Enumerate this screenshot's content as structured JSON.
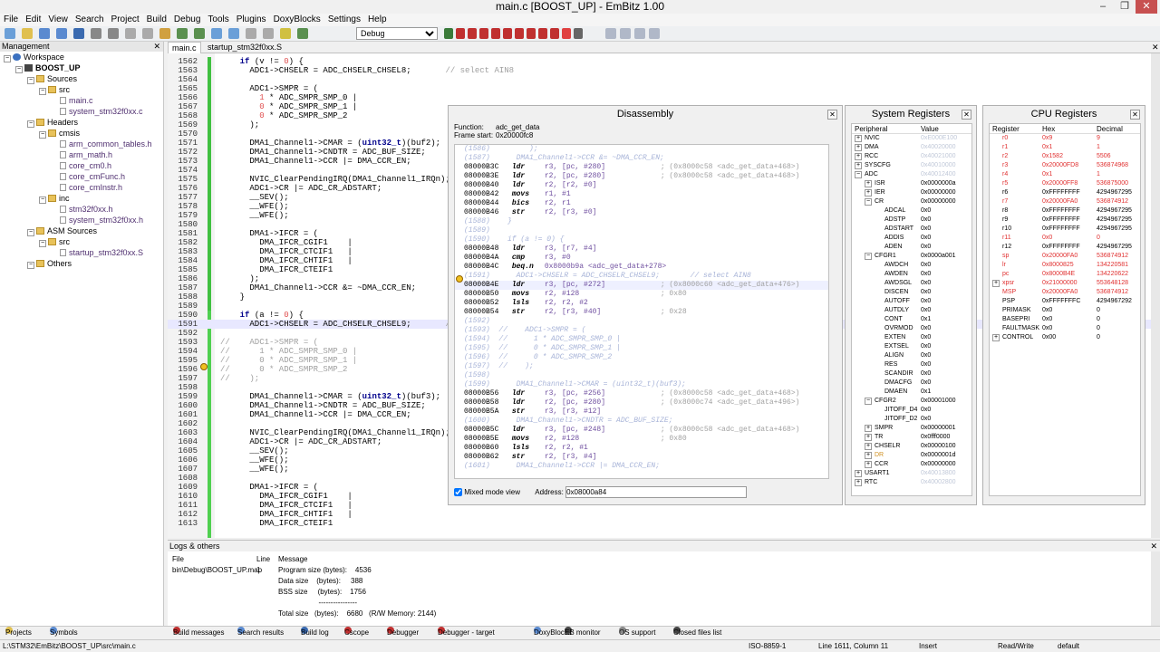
{
  "window": {
    "title": "main.c [BOOST_UP] - EmBitz 1.00"
  },
  "menu": [
    "File",
    "Edit",
    "View",
    "Search",
    "Project",
    "Build",
    "Debug",
    "Tools",
    "Plugins",
    "DoxyBlocks",
    "Settings",
    "Help"
  ],
  "toolbar": {
    "build_target": "Debug"
  },
  "management": {
    "title": "Management",
    "tree": [
      {
        "label": "Workspace",
        "indent": 0,
        "kind": "ws"
      },
      {
        "label": "BOOST_UP",
        "indent": 1,
        "kind": "proj"
      },
      {
        "label": "Sources",
        "indent": 2,
        "kind": "folder"
      },
      {
        "label": "src",
        "indent": 3,
        "kind": "folder"
      },
      {
        "label": "main.c",
        "indent": 4,
        "kind": "file"
      },
      {
        "label": "system_stm32f0xx.c",
        "indent": 4,
        "kind": "file"
      },
      {
        "label": "Headers",
        "indent": 2,
        "kind": "folder"
      },
      {
        "label": "cmsis",
        "indent": 3,
        "kind": "folder"
      },
      {
        "label": "arm_common_tables.h",
        "indent": 4,
        "kind": "file"
      },
      {
        "label": "arm_math.h",
        "indent": 4,
        "kind": "file"
      },
      {
        "label": "core_cm0.h",
        "indent": 4,
        "kind": "file"
      },
      {
        "label": "core_cmFunc.h",
        "indent": 4,
        "kind": "file"
      },
      {
        "label": "core_cmInstr.h",
        "indent": 4,
        "kind": "file"
      },
      {
        "label": "inc",
        "indent": 3,
        "kind": "folder"
      },
      {
        "label": "stm32f0xx.h",
        "indent": 4,
        "kind": "file"
      },
      {
        "label": "system_stm32f0xx.h",
        "indent": 4,
        "kind": "file"
      },
      {
        "label": "ASM Sources",
        "indent": 2,
        "kind": "folder"
      },
      {
        "label": "src",
        "indent": 3,
        "kind": "folder"
      },
      {
        "label": "startup_stm32f0xx.S",
        "indent": 4,
        "kind": "file"
      },
      {
        "label": "Others",
        "indent": 2,
        "kind": "folder"
      }
    ]
  },
  "editor": {
    "tabs": [
      "main.c",
      "startup_stm32f0xx.S"
    ],
    "lines": [
      {
        "n": "1562",
        "t": "    if (v != 0) {"
      },
      {
        "n": "1563",
        "t": "      ADC1->CHSELR = ADC_CHSELR_CHSEL8;       // select AIN8"
      },
      {
        "n": "1564",
        "t": ""
      },
      {
        "n": "1565",
        "t": "      ADC1->SMPR = ("
      },
      {
        "n": "1566",
        "t": "        1 * ADC_SMPR_SMP_0 |"
      },
      {
        "n": "1567",
        "t": "        0 * ADC_SMPR_SMP_1 |"
      },
      {
        "n": "1568",
        "t": "        0 * ADC_SMPR_SMP_2"
      },
      {
        "n": "1569",
        "t": "      );"
      },
      {
        "n": "1570",
        "t": ""
      },
      {
        "n": "1571",
        "t": "      DMA1_Channel1->CMAR = (uint32_t)(buf2);"
      },
      {
        "n": "1572",
        "t": "      DMA1_Channel1->CNDTR = ADC_BUF_SIZE;"
      },
      {
        "n": "1573",
        "t": "      DMA1_Channel1->CCR |= DMA_CCR_EN;"
      },
      {
        "n": "1574",
        "t": ""
      },
      {
        "n": "1575",
        "t": "      NVIC_ClearPendingIRQ(DMA1_Channel1_IRQn);"
      },
      {
        "n": "1576",
        "t": "      ADC1->CR |= ADC_CR_ADSTART;              // start th"
      },
      {
        "n": "1577",
        "t": "      __SEV();"
      },
      {
        "n": "1578",
        "t": "      __WFE();"
      },
      {
        "n": "1579",
        "t": "      __WFE();"
      },
      {
        "n": "1580",
        "t": ""
      },
      {
        "n": "1581",
        "t": "      DMA1->IFCR = ("
      },
      {
        "n": "1582",
        "t": "        DMA_IFCR_CGIF1    |"
      },
      {
        "n": "1583",
        "t": "        DMA_IFCR_CTCIF1   |"
      },
      {
        "n": "1584",
        "t": "        DMA_IFCR_CHTIF1   |"
      },
      {
        "n": "1585",
        "t": "        DMA_IFCR_CTEIF1"
      },
      {
        "n": "1586",
        "t": "      );"
      },
      {
        "n": "1587",
        "t": "      DMA1_Channel1->CCR &= ~DMA_CCR_EN;"
      },
      {
        "n": "1588",
        "t": "    }"
      },
      {
        "n": "1589",
        "t": ""
      },
      {
        "n": "1590",
        "t": "    if (a != 0) {"
      },
      {
        "n": "1591",
        "t": "      ADC1->CHSELR = ADC_CHSELR_CHSEL9;       // select A"
      },
      {
        "n": "1592",
        "t": ""
      },
      {
        "n": "1593",
        "t": "//    ADC1->SMPR = ("
      },
      {
        "n": "1594",
        "t": "//      1 * ADC_SMPR_SMP_0 |"
      },
      {
        "n": "1595",
        "t": "//      0 * ADC_SMPR_SMP_1 |"
      },
      {
        "n": "1596",
        "t": "//      0 * ADC_SMPR_SMP_2"
      },
      {
        "n": "1597",
        "t": "//    );"
      },
      {
        "n": "1598",
        "t": ""
      },
      {
        "n": "1599",
        "t": "      DMA1_Channel1->CMAR = (uint32_t)(buf3);"
      },
      {
        "n": "1600",
        "t": "      DMA1_Channel1->CNDTR = ADC_BUF_SIZE;"
      },
      {
        "n": "1601",
        "t": "      DMA1_Channel1->CCR |= DMA_CCR_EN;"
      },
      {
        "n": "1602",
        "t": ""
      },
      {
        "n": "1603",
        "t": "      NVIC_ClearPendingIRQ(DMA1_Channel1_IRQn);"
      },
      {
        "n": "1604",
        "t": "      ADC1->CR |= ADC_CR_ADSTART;              // start th"
      },
      {
        "n": "1605",
        "t": "      __SEV();"
      },
      {
        "n": "1606",
        "t": "      __WFE();"
      },
      {
        "n": "1607",
        "t": "      __WFE();"
      },
      {
        "n": "1608",
        "t": ""
      },
      {
        "n": "1609",
        "t": "      DMA1->IFCR = ("
      },
      {
        "n": "1610",
        "t": "        DMA_IFCR_CGIF1    |"
      },
      {
        "n": "1611",
        "t": "        DMA_IFCR_CTCIF1   |"
      },
      {
        "n": "1612",
        "t": "        DMA_IFCR_CHTIF1   |"
      },
      {
        "n": "1613",
        "t": "        DMA_IFCR_CTEIF1"
      }
    ]
  },
  "disassembly": {
    "title": "Disassembly",
    "function_label": "Function:",
    "function": "adc_get_data",
    "frame_label": "Frame start:",
    "frame": "0x20000fc8",
    "mixed_label": "Mixed mode view",
    "address_label": "Address:",
    "address": "0x08000a84",
    "lines": [
      {
        "s": 1,
        "t": "(1586)         );"
      },
      {
        "s": 1,
        "t": "(1587)      DMA1_Channel1->CCR &= ~DMA_CCR_EN;"
      },
      {
        "a": "08000B3C",
        "o": "ldr",
        "r": "r3, [pc, #280]",
        "c": "; (0x8000c58 <adc_get_data+468>)"
      },
      {
        "a": "08000B3E",
        "o": "ldr",
        "r": "r2, [pc, #280]",
        "c": "; (0x8000c58 <adc_get_data+468>)"
      },
      {
        "a": "08000B40",
        "o": "ldr",
        "r": "r2, [r2, #0]",
        "c": ""
      },
      {
        "a": "08000B42",
        "o": "movs",
        "r": "r1, #1",
        "c": ""
      },
      {
        "a": "08000B44",
        "o": "bics",
        "r": "r2, r1",
        "c": ""
      },
      {
        "a": "08000B46",
        "o": "str",
        "r": "r2, [r3, #0]",
        "c": ""
      },
      {
        "s": 1,
        "t": "(1588)    }"
      },
      {
        "s": 1,
        "t": "(1589)"
      },
      {
        "s": 1,
        "t": "(1590)    if (a != 0) {"
      },
      {
        "a": "08000B48",
        "o": "ldr",
        "r": "r3, [r7, #4]",
        "c": ""
      },
      {
        "a": "08000B4A",
        "o": "cmp",
        "r": "r3, #0",
        "c": ""
      },
      {
        "a": "08000B4C",
        "o": "beq.n",
        "r": "0x8000b9a <adc_get_data+278>",
        "c": ""
      },
      {
        "s": 1,
        "t": "(1591)      ADC1->CHSELR = ADC_CHSELR_CHSEL9;       // select AIN8"
      },
      {
        "a": "08000B4E",
        "o": "ldr",
        "r": "r3, [pc, #272]",
        "c": "; (0x8000c60 <adc_get_data+476>)",
        "hl": 1
      },
      {
        "a": "08000B50",
        "o": "movs",
        "r": "r2, #128",
        "c": "; 0x80"
      },
      {
        "a": "08000B52",
        "o": "lsls",
        "r": "r2, r2, #2",
        "c": ""
      },
      {
        "a": "08000B54",
        "o": "str",
        "r": "r2, [r3, #40]",
        "c": "; 0x28"
      },
      {
        "s": 1,
        "t": "(1592)"
      },
      {
        "s": 1,
        "t": "(1593)  //    ADC1->SMPR = ("
      },
      {
        "s": 1,
        "t": "(1594)  //      1 * ADC_SMPR_SMP_0 |"
      },
      {
        "s": 1,
        "t": "(1595)  //      0 * ADC_SMPR_SMP_1 |"
      },
      {
        "s": 1,
        "t": "(1596)  //      0 * ADC_SMPR_SMP_2"
      },
      {
        "s": 1,
        "t": "(1597)  //    );"
      },
      {
        "s": 1,
        "t": "(1598)"
      },
      {
        "s": 1,
        "t": "(1599)      DMA1_Channel1->CMAR = (uint32_t)(buf3);"
      },
      {
        "a": "08000B56",
        "o": "ldr",
        "r": "r3, [pc, #256]",
        "c": "; (0x8000c58 <adc_get_data+468>)"
      },
      {
        "a": "08000B58",
        "o": "ldr",
        "r": "r2, [pc, #280]",
        "c": "; (0x8000c74 <adc_get_data+496>)"
      },
      {
        "a": "08000B5A",
        "o": "str",
        "r": "r3, [r3, #12]",
        "c": ""
      },
      {
        "s": 1,
        "t": "(1600)      DMA1_Channel1->CNDTR = ADC_BUF_SIZE;"
      },
      {
        "a": "08000B5C",
        "o": "ldr",
        "r": "r3, [pc, #248]",
        "c": "; (0x8000c58 <adc_get_data+468>)"
      },
      {
        "a": "08000B5E",
        "o": "movs",
        "r": "r2, #128",
        "c": "; 0x80"
      },
      {
        "a": "08000B60",
        "o": "lsls",
        "r": "r2, r2, #1",
        "c": ""
      },
      {
        "a": "08000B62",
        "o": "str",
        "r": "r2, [r3, #4]",
        "c": ""
      },
      {
        "s": 1,
        "t": "(1601)      DMA1_Channel1->CCR |= DMA_CCR_EN;"
      }
    ]
  },
  "sysregs": {
    "title": "System Registers",
    "col_periph": "Peripheral",
    "col_value": "Value",
    "rows": [
      {
        "e": "+",
        "n": "NVIC",
        "v": "0xE000E100",
        "g": 1,
        "i": 0
      },
      {
        "e": "+",
        "n": "DMA",
        "v": "0x40020000",
        "g": 1,
        "i": 0
      },
      {
        "e": "+",
        "n": "RCC",
        "v": "0x40021000",
        "g": 1,
        "i": 0
      },
      {
        "e": "+",
        "n": "SYSCFG",
        "v": "0x40010000",
        "g": 1,
        "i": 0
      },
      {
        "e": "-",
        "n": "ADC",
        "v": "0x40012400",
        "g": 1,
        "i": 0
      },
      {
        "e": "+",
        "n": "ISR",
        "v": "0x0000000a",
        "i": 1
      },
      {
        "e": "+",
        "n": "IER",
        "v": "0x00000000",
        "i": 1
      },
      {
        "e": "-",
        "n": "CR",
        "v": "0x00000000",
        "i": 1
      },
      {
        "n": "ADCAL",
        "v": "0x0",
        "i": 2
      },
      {
        "n": "ADSTP",
        "v": "0x0",
        "i": 2
      },
      {
        "n": "ADSTART",
        "v": "0x0",
        "i": 2
      },
      {
        "n": "ADDIS",
        "v": "0x0",
        "i": 2
      },
      {
        "n": "ADEN",
        "v": "0x0",
        "i": 2
      },
      {
        "e": "-",
        "n": "CFGR1",
        "v": "0x0000a001",
        "i": 1
      },
      {
        "n": "AWDCH",
        "v": "0x0",
        "i": 2
      },
      {
        "n": "AWDEN",
        "v": "0x0",
        "i": 2
      },
      {
        "n": "AWDSGL",
        "v": "0x0",
        "i": 2
      },
      {
        "n": "DISCEN",
        "v": "0x0",
        "i": 2
      },
      {
        "n": "AUTOFF",
        "v": "0x0",
        "i": 2
      },
      {
        "n": "AUTDLY",
        "v": "0x0",
        "i": 2
      },
      {
        "n": "CONT",
        "v": "0x1",
        "i": 2
      },
      {
        "n": "OVRMOD",
        "v": "0x0",
        "i": 2
      },
      {
        "n": "EXTEN",
        "v": "0x0",
        "i": 2
      },
      {
        "n": "EXTSEL",
        "v": "0x0",
        "i": 2
      },
      {
        "n": "ALIGN",
        "v": "0x0",
        "i": 2
      },
      {
        "n": "RES",
        "v": "0x0",
        "i": 2
      },
      {
        "n": "SCANDIR",
        "v": "0x0",
        "i": 2
      },
      {
        "n": "DMACFG",
        "v": "0x0",
        "i": 2
      },
      {
        "n": "DMAEN",
        "v": "0x1",
        "i": 2
      },
      {
        "e": "-",
        "n": "CFGR2",
        "v": "0x00001000",
        "i": 1
      },
      {
        "n": "JITOFF_D4",
        "v": "0x0",
        "i": 2
      },
      {
        "n": "JITOFF_D2",
        "v": "0x0",
        "i": 2
      },
      {
        "e": "+",
        "n": "SMPR",
        "v": "0x00000001",
        "i": 1
      },
      {
        "e": "+",
        "n": "TR",
        "v": "0x0fff0000",
        "i": 1
      },
      {
        "e": "+",
        "n": "CHSELR",
        "v": "0x00000100",
        "i": 1
      },
      {
        "e": "+",
        "n": "DR",
        "v": "0x0000001d",
        "i": 1,
        "orange": 1
      },
      {
        "e": "+",
        "n": "CCR",
        "v": "0x00000000",
        "i": 1
      },
      {
        "e": "+",
        "n": "USART1",
        "v": "0x40013800",
        "g": 1,
        "i": 0
      },
      {
        "e": "+",
        "n": "RTC",
        "v": "0x40002800",
        "g": 1,
        "i": 0
      }
    ]
  },
  "cpuregs": {
    "title": "CPU Registers",
    "col_reg": "Register",
    "col_hex": "Hex",
    "col_dec": "Decimal",
    "rows": [
      {
        "n": "r0",
        "h": "0x9",
        "d": "9",
        "r": 1
      },
      {
        "n": "r1",
        "h": "0x1",
        "d": "1",
        "r": 1
      },
      {
        "n": "r2",
        "h": "0x1582",
        "d": "5506",
        "r": 1
      },
      {
        "n": "r3",
        "h": "0x20000FD8",
        "d": "536874968",
        "r": 1
      },
      {
        "n": "r4",
        "h": "0x1",
        "d": "1",
        "r": 1
      },
      {
        "n": "r5",
        "h": "0x20000FF8",
        "d": "536875000",
        "r": 1
      },
      {
        "n": "r6",
        "h": "0xFFFFFFFF",
        "d": "4294967295"
      },
      {
        "n": "r7",
        "h": "0x20000FA0",
        "d": "536874912",
        "r": 1
      },
      {
        "n": "r8",
        "h": "0xFFFFFFFF",
        "d": "4294967295"
      },
      {
        "n": "r9",
        "h": "0xFFFFFFFF",
        "d": "4294967295"
      },
      {
        "n": "r10",
        "h": "0xFFFFFFFF",
        "d": "4294967295"
      },
      {
        "n": "r11",
        "h": "0x0",
        "d": "0",
        "r": 1
      },
      {
        "n": "r12",
        "h": "0xFFFFFFFF",
        "d": "4294967295"
      },
      {
        "n": "sp",
        "h": "0x20000FA0",
        "d": "536874912",
        "r": 1
      },
      {
        "n": "lr",
        "h": "0x8000825",
        "d": "134220581",
        "r": 1
      },
      {
        "n": "pc",
        "h": "0x8000B4E",
        "d": "134220622",
        "r": 1
      },
      {
        "n": "xpsr",
        "h": "0x21000000",
        "d": "553648128",
        "r": 1,
        "e": "+"
      },
      {
        "n": "MSP",
        "h": "0x20000FA0",
        "d": "536874912",
        "r": 1
      },
      {
        "n": "PSP",
        "h": "0xFFFFFFFC",
        "d": "4294967292"
      },
      {
        "n": "PRIMASK",
        "h": "0x0",
        "d": "0"
      },
      {
        "n": "BASEPRI",
        "h": "0x0",
        "d": "0"
      },
      {
        "n": "FAULTMASK",
        "h": "0x0",
        "d": "0"
      },
      {
        "n": "CONTROL",
        "h": "0x00",
        "d": "0",
        "e": "+"
      }
    ]
  },
  "logs": {
    "title": "Logs & others",
    "col_file": "File",
    "col_line": "Line",
    "col_msg": "Message",
    "rows": [
      {
        "f": "bin\\Debug\\BOOST_UP.map",
        "l": "1",
        "m": "Program size (bytes):    4536"
      },
      {
        "f": "",
        "l": "",
        "m": "Data size    (bytes):     388"
      },
      {
        "f": "",
        "l": "",
        "m": "BSS size     (bytes):    1756"
      },
      {
        "f": "",
        "l": "",
        "m": "                    ----------------"
      },
      {
        "f": "",
        "l": "",
        "m": "Total size   (bytes):    6680   (R/W Memory: 2144)"
      }
    ]
  },
  "bottom_tabs": {
    "left": [
      "Projects",
      "Symbols"
    ],
    "right": [
      "Build messages",
      "Search results",
      "Build log",
      "Cscope",
      "Debugger",
      "Debugger - target",
      "DoxyBlocks",
      "EB monitor",
      "OS support",
      "Closed files list"
    ]
  },
  "status": {
    "path": "L:\\STM32\\EmBitz\\BOOST_UP\\src\\main.c",
    "encoding": "ISO-8859-1",
    "position": "Line 1611, Column 11",
    "mode": "Insert",
    "access": "Read/Write",
    "profile": "default"
  },
  "colors": {
    "keyword": "#00008b",
    "comment": "#a0a0a0",
    "number": "#e05050",
    "changed": "#40c040",
    "register_changed": "#e03030"
  }
}
